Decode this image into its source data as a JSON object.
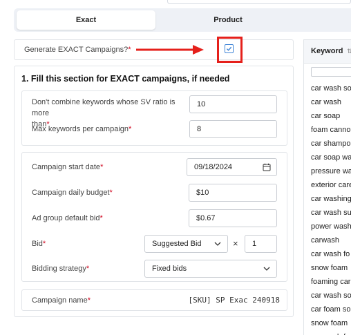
{
  "tabs": [
    {
      "label": "Exact",
      "active": true
    },
    {
      "label": "Product",
      "active": false
    }
  ],
  "generate_exact": {
    "label": "Generate EXACT Campaigns?",
    "required_mark": "*",
    "checked": true
  },
  "section": {
    "title": "1. Fill this section for EXACT campaigns, if needed"
  },
  "fields": {
    "sv_ratio": {
      "label_line1": "Don't combine keywords whose SV ratio is more",
      "label_line2": "than",
      "required_mark": "*",
      "value": "10"
    },
    "max_keywords": {
      "label": "Max keywords per campaign",
      "required_mark": "*",
      "value": "8"
    },
    "start_date": {
      "label": "Campaign start date",
      "required_mark": "*",
      "value": "09/18/2024"
    },
    "daily_budget": {
      "label": "Campaign daily budget",
      "required_mark": "*",
      "value": "$10"
    },
    "default_bid": {
      "label": "Ad group default bid",
      "required_mark": "*",
      "value": "$0.67"
    },
    "bid": {
      "label": "Bid",
      "required_mark": "*",
      "selected": "Suggested Bid",
      "multiplier_symbol": "×",
      "multiplier": "1"
    },
    "bidding_strategy": {
      "label": "Bidding strategy",
      "required_mark": "*",
      "selected": "Fixed bids"
    },
    "campaign_name": {
      "label": "Campaign name",
      "required_mark": "*",
      "value": "[SKU] SP Exac 240918"
    }
  },
  "keywords": {
    "header": "Keyword",
    "sort_icon": "sort-icon",
    "items": [
      "car wash so",
      "car wash",
      "car soap",
      "foam canno",
      "car shampo",
      "car soap wa",
      "pressure wa",
      "exterior care",
      "car washing",
      "car wash su",
      "power wash",
      "carwash",
      "car wash fo",
      "snow foam",
      "foaming car",
      "car wash so",
      "car foam so",
      "snow foam",
      "car wash fo"
    ]
  },
  "colors": {
    "highlight": "#e5201b",
    "accent": "#3b82d6",
    "required": "#d0021b"
  }
}
